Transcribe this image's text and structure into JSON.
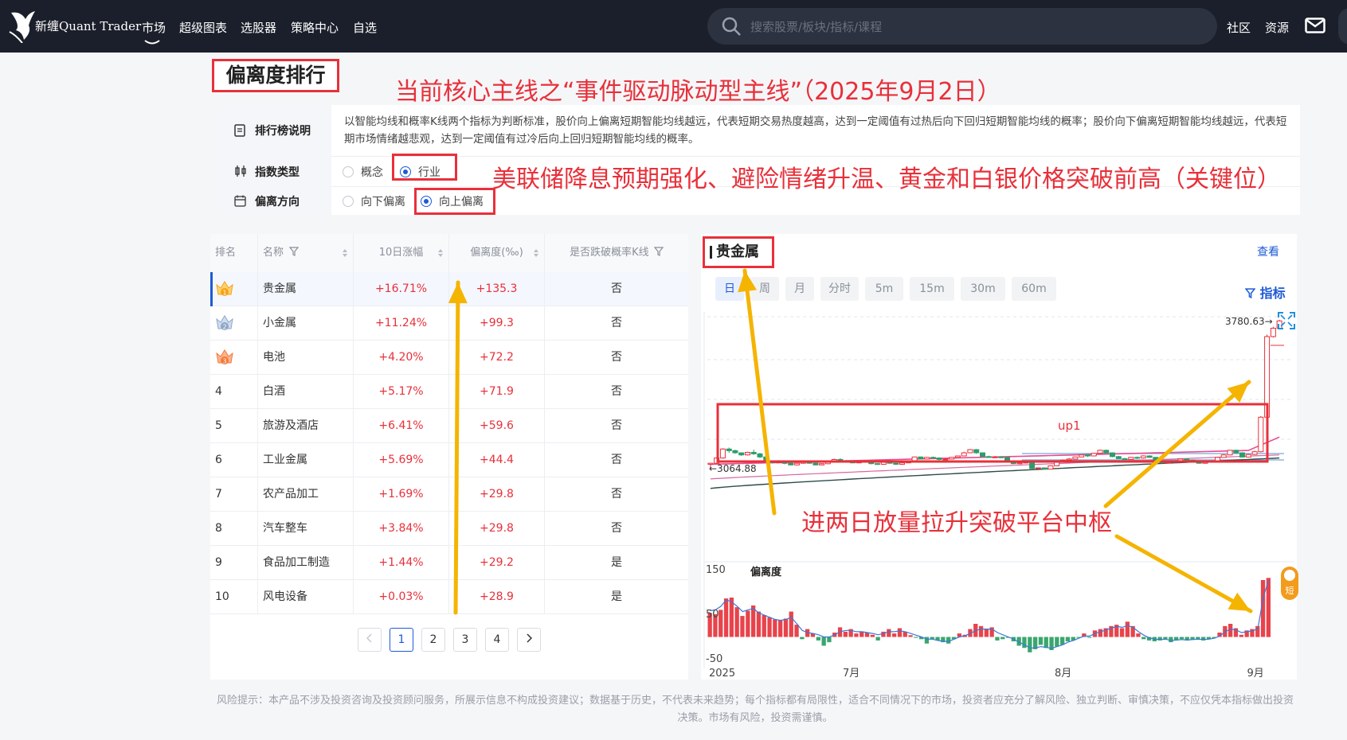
{
  "nav": {
    "brand": "新缠Quant Trader",
    "items": [
      {
        "label": "市场",
        "x": 178
      },
      {
        "label": "超级图表",
        "x": 225
      },
      {
        "label": "选股器",
        "x": 302
      },
      {
        "label": "策略中心",
        "x": 365
      },
      {
        "label": "自选",
        "x": 443
      }
    ],
    "search_placeholder": "搜索股票/板块/指标/课程",
    "right_links": [
      {
        "label": "社区",
        "x": 1540
      },
      {
        "label": "资源",
        "x": 1588
      }
    ]
  },
  "page_title": "偏离度排行",
  "annotations": {
    "headline": "当前核心主线之“事件驱动脉动型主线”（2025年9月2日）",
    "catalyst": "美联储降息预期强化、避险情绪升温、黄金和白银价格突破前高（关键位）",
    "breakout": "进两日放量拉升突破平台中枢"
  },
  "settings": {
    "description_label": "排行榜说明",
    "description_text": "以智能均线和概率K线两个指标为判断标准，股价向上偏离短期智能均线越远，代表短期交易热度越高，达到一定阈值有过热后向下回归短期智能均线的概率；股价向下偏离短期智能均线越远，代表短期市场情绪越悲观，达到一定阈值有过冷后向上回归短期智能均线的概率。",
    "index_type_label": "指数类型",
    "index_type_options": [
      "概念",
      "行业"
    ],
    "index_type_selected": "行业",
    "direction_label": "偏离方向",
    "direction_options": [
      "向下偏离",
      "向上偏离"
    ],
    "direction_selected": "向上偏离"
  },
  "table": {
    "headers": [
      "排名",
      "名称",
      "10日涨幅",
      "偏离度(‰)",
      "是否跌破概率K线"
    ],
    "rows": [
      {
        "rank": "1",
        "name": "贵金属",
        "change": "+16.71%",
        "deviation": "+135.3",
        "breakdown": "否"
      },
      {
        "rank": "2",
        "name": "小金属",
        "change": "+11.24%",
        "deviation": "+99.3",
        "breakdown": "否"
      },
      {
        "rank": "3",
        "name": "电池",
        "change": "+4.20%",
        "deviation": "+72.2",
        "breakdown": "否"
      },
      {
        "rank": "4",
        "name": "白酒",
        "change": "+5.17%",
        "deviation": "+71.9",
        "breakdown": "否"
      },
      {
        "rank": "5",
        "name": "旅游及酒店",
        "change": "+6.41%",
        "deviation": "+59.6",
        "breakdown": "否"
      },
      {
        "rank": "6",
        "name": "工业金属",
        "change": "+5.69%",
        "deviation": "+44.4",
        "breakdown": "否"
      },
      {
        "rank": "7",
        "name": "农产品加工",
        "change": "+1.69%",
        "deviation": "+29.8",
        "breakdown": "否"
      },
      {
        "rank": "8",
        "name": "汽车整车",
        "change": "+3.84%",
        "deviation": "+29.8",
        "breakdown": "否"
      },
      {
        "rank": "9",
        "name": "食品加工制造",
        "change": "+1.44%",
        "deviation": "+29.2",
        "breakdown": "是"
      },
      {
        "rank": "10",
        "name": "风电设备",
        "change": "+0.03%",
        "deviation": "+28.9",
        "breakdown": "是"
      }
    ],
    "pages": [
      "1",
      "2",
      "3",
      "4"
    ],
    "current_page": "1"
  },
  "chart": {
    "title": "贵金属",
    "view_label": "查看",
    "periods": [
      "日",
      "周",
      "月",
      "分时",
      "5m",
      "15m",
      "30m",
      "60m"
    ],
    "active_period": "日",
    "indicator_label": "指标",
    "short_badge": "短"
  },
  "chart_data": {
    "type": "candlestick",
    "title": "贵金属",
    "price_high_label": "3780.63→",
    "price_low_label": "←3064.88",
    "price_high": 3780.63,
    "price_low": 3064.88,
    "band_label": "up1",
    "subchart": {
      "title": "偏离度",
      "type": "bar",
      "y_ticks": [
        "150",
        "50",
        "-50"
      ],
      "ylim": [
        -50,
        150
      ],
      "values": [
        55,
        52,
        62,
        88,
        90,
        68,
        48,
        60,
        72,
        58,
        50,
        45,
        40,
        38,
        42,
        58,
        28,
        -5,
        18,
        8,
        -8,
        -20,
        -12,
        10,
        22,
        12,
        18,
        8,
        12,
        10,
        5,
        -8,
        12,
        18,
        8,
        20,
        12,
        4,
        -2,
        -5,
        -15,
        -5,
        -8,
        -12,
        -15,
        -5,
        8,
        5,
        18,
        30,
        25,
        18,
        22,
        -8,
        -5,
        -2,
        -10,
        -20,
        -25,
        -35,
        -28,
        -18,
        -25,
        -30,
        -22,
        -18,
        -10,
        -8,
        -2,
        8,
        -2,
        15,
        18,
        20,
        25,
        28,
        20,
        35,
        25,
        8,
        -5,
        -8,
        -10,
        -8,
        -5,
        -12,
        -8,
        -5,
        -8,
        -6,
        -5,
        -8,
        -5,
        -3,
        10,
        25,
        30,
        20,
        5,
        15,
        18,
        25,
        130,
        135
      ],
      "line": [
        60,
        62,
        70,
        85,
        80,
        70,
        58,
        62,
        65,
        55,
        50,
        45,
        40,
        38,
        40,
        45,
        30,
        15,
        10,
        8,
        5,
        0,
        0,
        5,
        12,
        15,
        15,
        12,
        12,
        10,
        8,
        5,
        8,
        12,
        12,
        14,
        12,
        8,
        4,
        0,
        -5,
        -5,
        -8,
        -10,
        -10,
        -5,
        0,
        3,
        8,
        15,
        18,
        18,
        18,
        10,
        5,
        0,
        -5,
        -12,
        -18,
        -25,
        -25,
        -22,
        -24,
        -26,
        -22,
        -18,
        -12,
        -8,
        -3,
        2,
        2,
        8,
        12,
        16,
        20,
        24,
        22,
        26,
        22,
        12,
        4,
        -2,
        -5,
        -6,
        -5,
        -8,
        -7,
        -6,
        -7,
        -6,
        -5,
        -6,
        -5,
        -3,
        2,
        12,
        18,
        16,
        10,
        12,
        14,
        18,
        90,
        130
      ],
      "x_ticks": [
        {
          "label": "2025",
          "pos": 0.0
        },
        {
          "label": "7月",
          "pos": 0.24
        },
        {
          "label": "8月",
          "pos": 0.62
        },
        {
          "label": "9月",
          "pos": 0.965
        }
      ]
    },
    "candles": [
      [
        3095,
        3100,
        3075,
        3102
      ],
      [
        3100,
        3125,
        3098,
        3128
      ],
      [
        3125,
        3168,
        3122,
        3172
      ],
      [
        3168,
        3160,
        3150,
        3175
      ],
      [
        3160,
        3150,
        3145,
        3165
      ],
      [
        3150,
        3140,
        3135,
        3152
      ],
      [
        3140,
        3152,
        3137,
        3155
      ],
      [
        3152,
        3145,
        3140,
        3165
      ],
      [
        3145,
        3130,
        3125,
        3150
      ],
      [
        3130,
        3110,
        3105,
        3132
      ],
      [
        3110,
        3102,
        3100,
        3114
      ],
      [
        3102,
        3112,
        3100,
        3115
      ],
      [
        3112,
        3100,
        3095,
        3114
      ],
      [
        3100,
        3092,
        3090,
        3102
      ],
      [
        3092,
        3100,
        3090,
        3103
      ],
      [
        3100,
        3105,
        3098,
        3108
      ],
      [
        3105,
        3100,
        3098,
        3108
      ],
      [
        3100,
        3092,
        3090,
        3103
      ],
      [
        3092,
        3098,
        3090,
        3100
      ],
      [
        3098,
        3110,
        3096,
        3112
      ],
      [
        3110,
        3118,
        3108,
        3122
      ],
      [
        3118,
        3112,
        3110,
        3125
      ],
      [
        3112,
        3108,
        3105,
        3115
      ],
      [
        3108,
        3102,
        3100,
        3110
      ],
      [
        3102,
        3110,
        3100,
        3113
      ],
      [
        3110,
        3108,
        3105,
        3116
      ],
      [
        3108,
        3098,
        3095,
        3110
      ],
      [
        3098,
        3095,
        3092,
        3100
      ],
      [
        3095,
        3105,
        3093,
        3108
      ],
      [
        3105,
        3100,
        3098,
        3106
      ],
      [
        3100,
        3095,
        3092,
        3102
      ],
      [
        3095,
        3102,
        3093,
        3105
      ],
      [
        3102,
        3108,
        3100,
        3110
      ],
      [
        3108,
        3130,
        3106,
        3132
      ],
      [
        3130,
        3120,
        3118,
        3132
      ],
      [
        3120,
        3128,
        3118,
        3130
      ],
      [
        3128,
        3125,
        3120,
        3132
      ],
      [
        3125,
        3118,
        3115,
        3128
      ],
      [
        3118,
        3120,
        3116,
        3124
      ],
      [
        3120,
        3128,
        3118,
        3130
      ],
      [
        3128,
        3135,
        3126,
        3137
      ],
      [
        3135,
        3150,
        3134,
        3155
      ],
      [
        3150,
        3165,
        3148,
        3168
      ],
      [
        3165,
        3150,
        3145,
        3168
      ],
      [
        3150,
        3132,
        3130,
        3152
      ],
      [
        3132,
        3128,
        3126,
        3136
      ],
      [
        3128,
        3130,
        3126,
        3135
      ],
      [
        3130,
        3128,
        3126,
        3134
      ],
      [
        3128,
        3108,
        3105,
        3130
      ],
      [
        3108,
        3098,
        3095,
        3110
      ],
      [
        3098,
        3102,
        3096,
        3104
      ],
      [
        3102,
        3105,
        3100,
        3108
      ],
      [
        3105,
        3075,
        3073,
        3107
      ],
      [
        3075,
        3078,
        3074,
        3080
      ],
      [
        3078,
        3072,
        3070,
        3080
      ],
      [
        3072,
        3088,
        3070,
        3090
      ],
      [
        3088,
        3108,
        3086,
        3110
      ],
      [
        3108,
        3115,
        3105,
        3118
      ],
      [
        3115,
        3120,
        3112,
        3125
      ],
      [
        3120,
        3130,
        3118,
        3132
      ],
      [
        3130,
        3140,
        3128,
        3142
      ],
      [
        3140,
        3135,
        3130,
        3144
      ],
      [
        3135,
        3148,
        3133,
        3150
      ],
      [
        3148,
        3162,
        3146,
        3165
      ],
      [
        3162,
        3150,
        3148,
        3165
      ],
      [
        3150,
        3132,
        3128,
        3152
      ],
      [
        3132,
        3122,
        3120,
        3135
      ],
      [
        3122,
        3118,
        3116,
        3126
      ],
      [
        3118,
        3128,
        3116,
        3130
      ],
      [
        3128,
        3125,
        3120,
        3132
      ],
      [
        3125,
        3135,
        3122,
        3138
      ],
      [
        3135,
        3128,
        3126,
        3138
      ],
      [
        3128,
        3112,
        3110,
        3130
      ],
      [
        3112,
        3102,
        3100,
        3115
      ],
      [
        3102,
        3105,
        3100,
        3108
      ],
      [
        3105,
        3110,
        3102,
        3112
      ],
      [
        3110,
        3120,
        3108,
        3123
      ],
      [
        3120,
        3115,
        3112,
        3124
      ],
      [
        3115,
        3108,
        3106,
        3118
      ],
      [
        3108,
        3100,
        3098,
        3110
      ],
      [
        3100,
        3105,
        3098,
        3108
      ],
      [
        3105,
        3110,
        3103,
        3112
      ],
      [
        3110,
        3128,
        3108,
        3130
      ],
      [
        3128,
        3140,
        3126,
        3143
      ],
      [
        3140,
        3162,
        3138,
        3164
      ],
      [
        3162,
        3150,
        3148,
        3165
      ],
      [
        3150,
        3130,
        3128,
        3153
      ],
      [
        3130,
        3142,
        3128,
        3145
      ],
      [
        3142,
        3155,
        3140,
        3160
      ],
      [
        3155,
        3320,
        3152,
        3325
      ],
      [
        3320,
        3705,
        3318,
        3715
      ],
      [
        3705,
        3745,
        3700,
        3752
      ],
      [
        3745,
        3780,
        3740,
        3785
      ]
    ]
  },
  "footer": "风险提示：本产品不涉及投资咨询及投资顾问服务，所展示信息不构成投资建议；数据基于历史，不代表未来趋势；每个指标都有局限性，适合不同情况下的市场，投资者应充分了解风险、独立判断、审慎决策，不应仅凭本指标做出投资决策。市场有风险，投资需谨慎。"
}
